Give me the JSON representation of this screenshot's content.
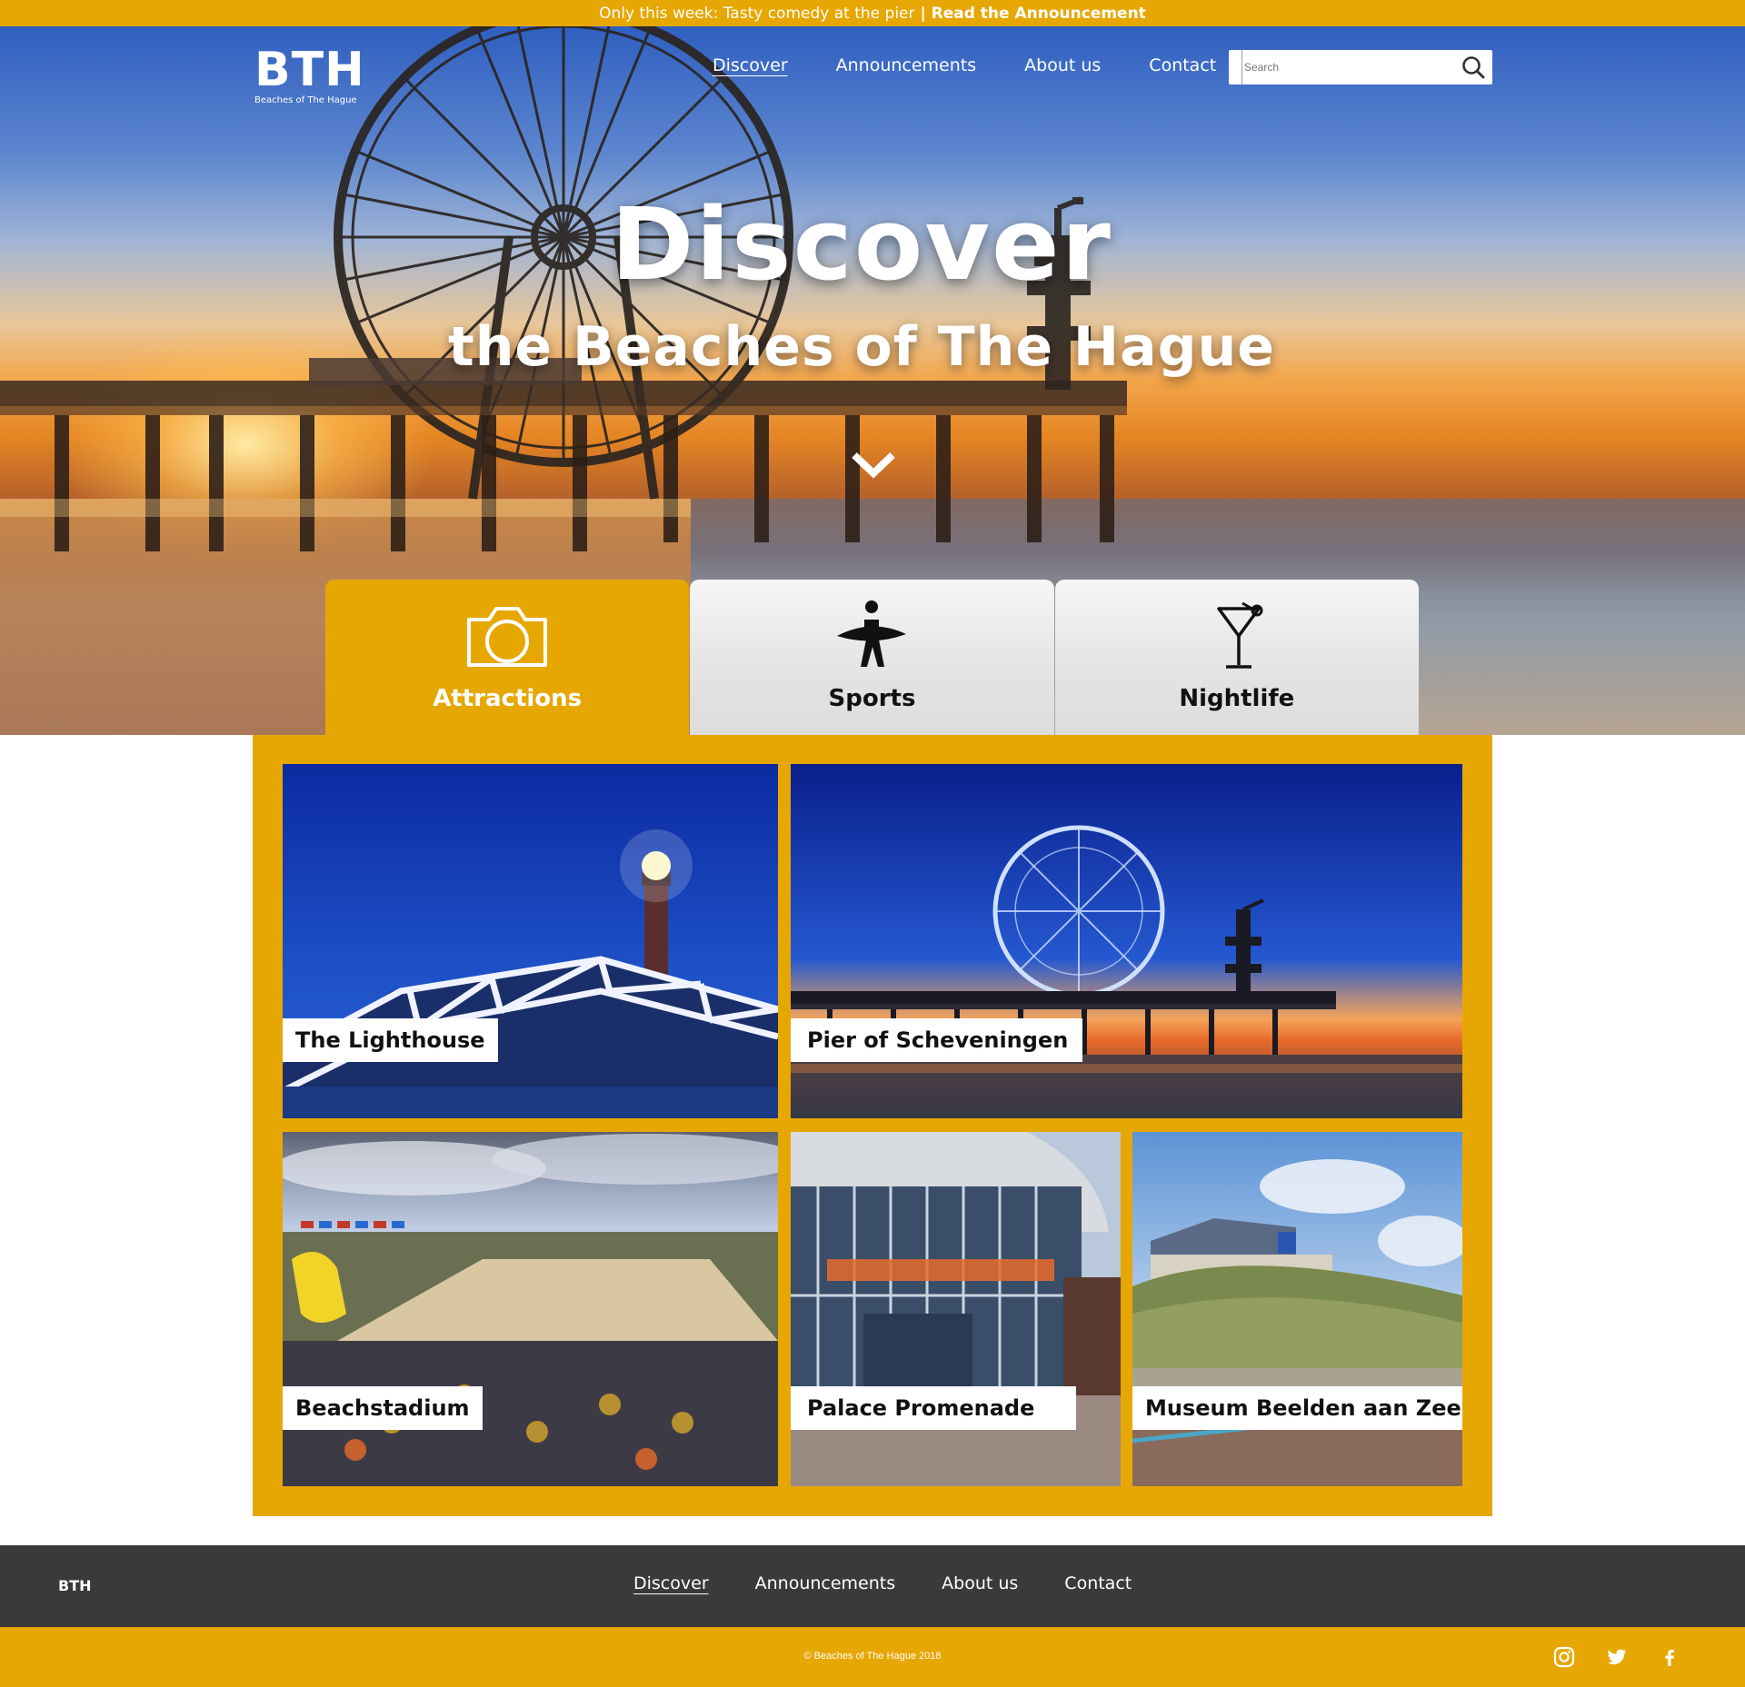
{
  "announcement": {
    "text": "Only this week: Tasty comedy at the pier",
    "link_label": "| Read the Announcement"
  },
  "header": {
    "logo_mark": "BTH",
    "logo_sub": "Beaches of The Hague",
    "nav": [
      {
        "label": "Discover",
        "active": true
      },
      {
        "label": "Announcements"
      },
      {
        "label": "About us"
      },
      {
        "label": "Contact"
      }
    ],
    "search_placeholder": "Search"
  },
  "hero": {
    "title": "Discover",
    "subtitle": "the Beaches of The Hague"
  },
  "categories": [
    {
      "label": "Attractions",
      "icon": "camera-icon",
      "active": true
    },
    {
      "label": "Sports",
      "icon": "surfer-icon"
    },
    {
      "label": "Nightlife",
      "icon": "cocktail-icon"
    }
  ],
  "attractions": [
    {
      "label": "The Lighthouse"
    },
    {
      "label": "Pier of Scheveningen"
    },
    {
      "label": "Beachstadium"
    },
    {
      "label": "Palace Promenade"
    },
    {
      "label": "Museum Beelden aan Zee"
    }
  ],
  "footer": {
    "brand": "BTH",
    "nav": [
      {
        "label": "Discover",
        "active": true
      },
      {
        "label": "Announcements"
      },
      {
        "label": "About us"
      },
      {
        "label": "Contact"
      }
    ],
    "copyright": "© Beaches of The Hague 2018",
    "socials": [
      "instagram-icon",
      "twitter-icon",
      "facebook-icon"
    ]
  },
  "colors": {
    "accent": "#e7a702",
    "footer_dark": "#3a3a3a"
  }
}
